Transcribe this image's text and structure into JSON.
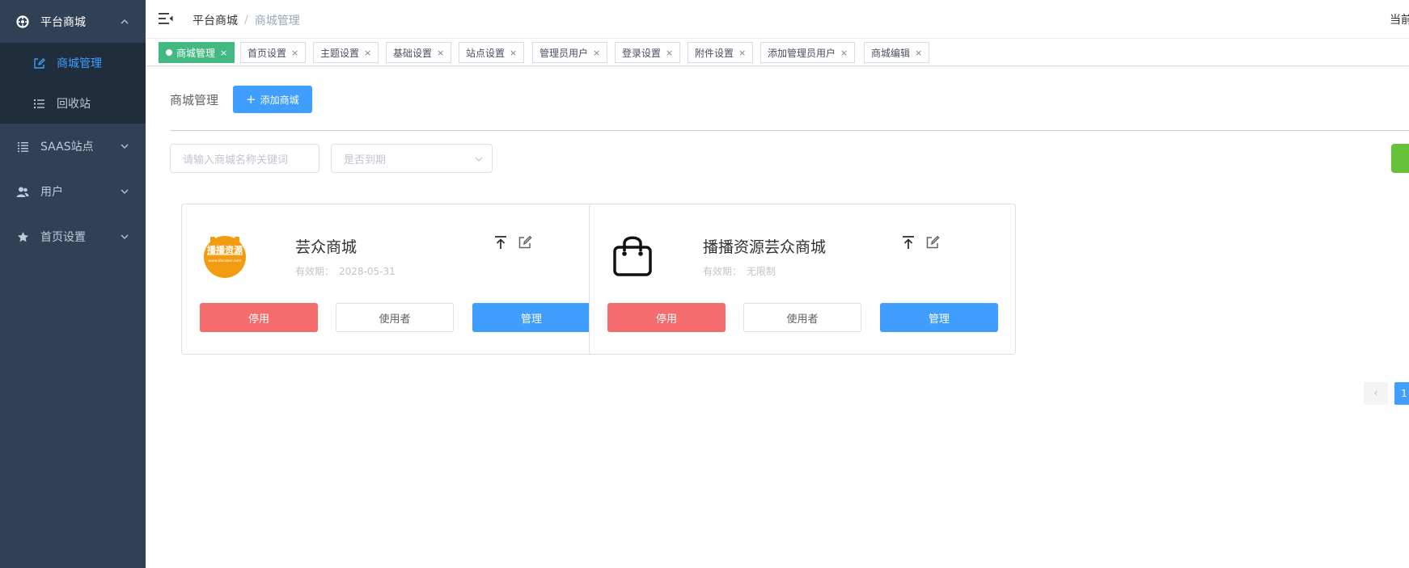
{
  "colors": {
    "sidebar": "#304156",
    "submenu": "#1f2d3d",
    "accent": "#409eff",
    "tag_active": "#42b983",
    "danger": "#f56c6c",
    "success": "#67c23a"
  },
  "sidebar": {
    "items": [
      {
        "label": "平台商城",
        "icon": "aperture-icon",
        "chevron": "chevron-up-icon",
        "children": [
          {
            "label": "商城管理",
            "icon": "edit-icon",
            "active": true
          },
          {
            "label": "回收站",
            "icon": "list-icon"
          }
        ]
      },
      {
        "label": "SAAS站点",
        "icon": "list-icon",
        "chevron": "chevron-down-icon"
      },
      {
        "label": "用户",
        "icon": "user-icon",
        "chevron": "chevron-down-icon"
      },
      {
        "label": "首页设置",
        "icon": "star-icon",
        "chevron": "chevron-down-icon"
      }
    ]
  },
  "navbar": {
    "breadcrumb": [
      "平台商城",
      "商城管理"
    ],
    "separator": "/",
    "right_text": "当前"
  },
  "tags": [
    {
      "label": "商城管理",
      "active": true
    },
    {
      "label": "首页设置"
    },
    {
      "label": "主题设置"
    },
    {
      "label": "基础设置"
    },
    {
      "label": "站点设置"
    },
    {
      "label": "管理员用户"
    },
    {
      "label": "登录设置"
    },
    {
      "label": "附件设置"
    },
    {
      "label": "添加管理员用户"
    },
    {
      "label": "商城编辑"
    }
  ],
  "tag_close": "×",
  "main": {
    "title": "商城管理",
    "add_button": "添加商城",
    "search_placeholder": "请输入商城名称关键词",
    "select_placeholder": "是否到期"
  },
  "cards": [
    {
      "name": "芸众商城",
      "expiry_label": "有效期：",
      "expiry_value": "2028-05-31",
      "logo": "brand-logo-icon",
      "logo_text": "播播资源",
      "logo_subtext": "www.bbsuber.com",
      "stop": "停用",
      "users": "使用者",
      "manage": "管理"
    },
    {
      "name": "播播资源芸众商城",
      "expiry_label": "有效期：",
      "expiry_value": "无限制",
      "logo": "shopping-bag-icon",
      "stop": "停用",
      "users": "使用者",
      "manage": "管理"
    }
  ],
  "pagination": {
    "prev": "‹",
    "current": "1"
  }
}
